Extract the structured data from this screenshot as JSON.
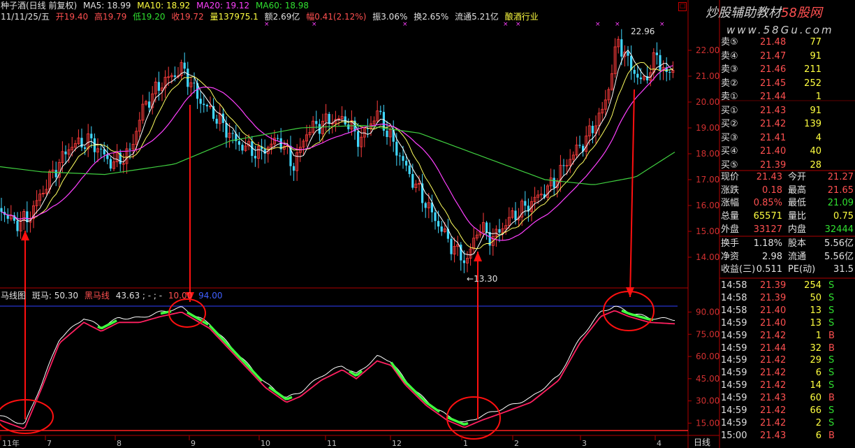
{
  "header": {
    "stock": "种子酒(日线 前复权)",
    "ma5": "MA5: 18.99",
    "ma10": "MA10: 18.92",
    "ma20": "MA20: 19.12",
    "ma60": "MA60: 18.98",
    "date": "11/11/25/五",
    "open": "开19.40",
    "high": "高19.79",
    "low": "低19.20",
    "close": "收19.72",
    "vol": "量137975.1",
    "amount": "额2.69亿",
    "change": "幅0.41(2.12%)",
    "amp": "振3.06%",
    "turnover": "换2.65%",
    "float": "流通5.21亿",
    "sector": "酿酒行业"
  },
  "sub_header": {
    "name": "马线图",
    "zebra": "斑马: 50.30",
    "black": "黑马线",
    "black_val": "43.63 ; - ; -",
    "v1": "10.00",
    "v2": "94.00"
  },
  "annotations": {
    "high_label": "22.96",
    "low_label": "13.30"
  },
  "price_axis": [
    "22.00",
    "21.00",
    "20.00",
    "19.00",
    "18.00",
    "17.00",
    "16.00",
    "15.00",
    "14.00"
  ],
  "osc_axis": [
    "90.00",
    "75.00",
    "60.00",
    "45.00",
    "30.00",
    "15.00"
  ],
  "date_axis": [
    "11年",
    "7",
    "8",
    "9",
    "10",
    "11",
    "12",
    "1",
    "2",
    "3",
    "4"
  ],
  "bottom_label": "日线",
  "watermark": {
    "line1": "炒股辅助教材",
    "site": "58股网",
    "line2": "www.58Gu.com"
  },
  "order_book": [
    {
      "label": "卖⑤",
      "price": "21.48",
      "vol": "77"
    },
    {
      "label": "卖④",
      "price": "21.47",
      "vol": "91"
    },
    {
      "label": "卖③",
      "price": "21.46",
      "vol": "211"
    },
    {
      "label": "卖②",
      "price": "21.45",
      "vol": "252"
    },
    {
      "label": "卖①",
      "price": "21.44",
      "vol": "1"
    },
    {
      "label": "买①",
      "price": "21.43",
      "vol": "91"
    },
    {
      "label": "买②",
      "price": "21.42",
      "vol": "139"
    },
    {
      "label": "买③",
      "price": "21.41",
      "vol": "4"
    },
    {
      "label": "买④",
      "price": "21.40",
      "vol": "40"
    },
    {
      "label": "买⑤",
      "price": "21.39",
      "vol": "28"
    }
  ],
  "quote": [
    {
      "l1": "现价",
      "v1": "21.43",
      "c1": "red",
      "l2": "今开",
      "v2": "21.27",
      "c2": "red"
    },
    {
      "l1": "涨跌",
      "v1": "0.18",
      "c1": "red",
      "l2": "最高",
      "v2": "21.65",
      "c2": "red"
    },
    {
      "l1": "涨幅",
      "v1": "0.85%",
      "c1": "red",
      "l2": "最低",
      "v2": "21.09",
      "c2": "green"
    },
    {
      "l1": "总量",
      "v1": "65571",
      "c1": "yellow",
      "l2": "量比",
      "v2": "0.75",
      "c2": "yellow"
    },
    {
      "l1": "外盘",
      "v1": "33127",
      "c1": "red",
      "l2": "内盘",
      "v2": "32444",
      "c2": "green"
    }
  ],
  "fundamentals": [
    {
      "l1": "换手",
      "v1": "1.18%",
      "l2": "股本",
      "v2": "5.56亿"
    },
    {
      "l1": "净资",
      "v1": "2.98",
      "l2": "流通",
      "v2": "5.56亿"
    },
    {
      "l1": "收益(三)",
      "v1": "0.511",
      "l2": "PE(动)",
      "v2": "31.5"
    }
  ],
  "ticks": [
    {
      "time": "14:58",
      "price": "21.39",
      "vol": "254",
      "side": "S"
    },
    {
      "time": "14:58",
      "price": "21.39",
      "vol": "50",
      "side": "S"
    },
    {
      "time": "14:58",
      "price": "21.40",
      "vol": "13",
      "side": "S"
    },
    {
      "time": "14:59",
      "price": "21.40",
      "vol": "13",
      "side": "S"
    },
    {
      "time": "14:59",
      "price": "21.42",
      "vol": "1",
      "side": "B"
    },
    {
      "time": "14:59",
      "price": "21.44",
      "vol": "32",
      "side": "B"
    },
    {
      "time": "14:59",
      "price": "21.42",
      "vol": "29",
      "side": "S"
    },
    {
      "time": "14:59",
      "price": "21.42",
      "vol": "6",
      "side": "S"
    },
    {
      "time": "14:59",
      "price": "21.42",
      "vol": "14",
      "side": "S"
    },
    {
      "time": "14:59",
      "price": "21.43",
      "vol": "60",
      "side": "B"
    },
    {
      "time": "14:59",
      "price": "21.42",
      "vol": "66",
      "side": "S"
    },
    {
      "time": "14:59",
      "price": "21.42",
      "vol": "2",
      "side": "S"
    },
    {
      "time": "15:00",
      "price": "21.43",
      "vol": "6",
      "side": "B"
    }
  ],
  "chart_data": {
    "type": "candlestick",
    "price_range": [
      13.3,
      22.96
    ],
    "oscillator_range": [
      10,
      94
    ],
    "colors": {
      "up": "#ff3c3c",
      "down": "#40d8ff",
      "ma5": "#ffffff",
      "ma10": "#ffff60",
      "ma20": "#ff40ff",
      "ma60": "#40d040",
      "osc_white": "#ffffff",
      "osc_red": "#ff2060",
      "osc_green": "#40ff40"
    }
  }
}
